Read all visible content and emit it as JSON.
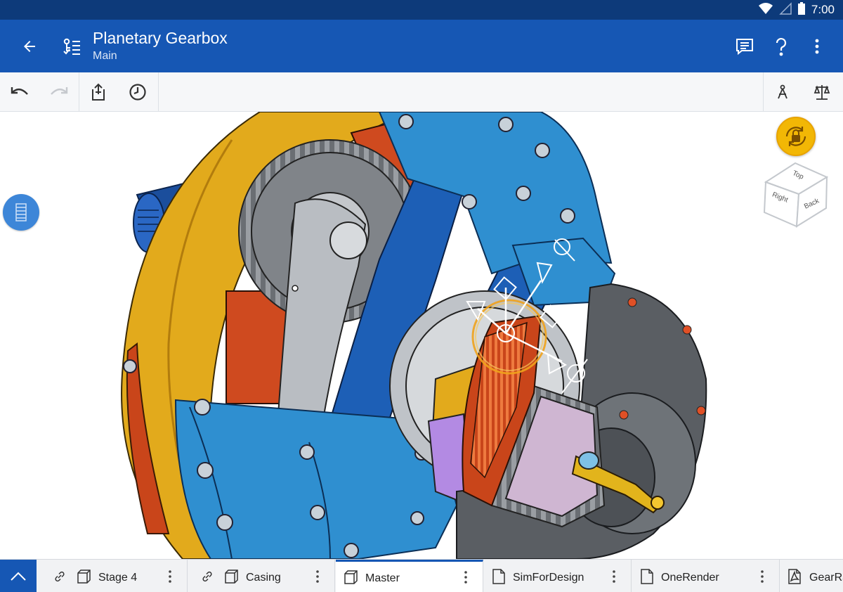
{
  "status_bar": {
    "time": "7:00",
    "icons": [
      "wifi-icon",
      "signal-icon",
      "battery-icon"
    ]
  },
  "header": {
    "title": "Planetary Gearbox",
    "subtitle": "Main",
    "actions": [
      "back-arrow-icon",
      "feature-tree-icon",
      "comments-icon",
      "help-icon",
      "overflow-menu-icon"
    ]
  },
  "toolbar": {
    "left_tools": [
      "undo-icon",
      "redo-icon",
      "export-icon",
      "history-icon"
    ],
    "right_tools": [
      "measure-icon",
      "mass-properties-icon"
    ]
  },
  "view_cube": {
    "top": "Top",
    "right": "Right",
    "back": "Back"
  },
  "colors": {
    "status_bar": "#0d3a7a",
    "header": "#1657b4",
    "accent": "#f2b705",
    "gear_blue": "#2f8fd0",
    "gear_gold": "#e2aa1c",
    "gear_orange": "#d9501e",
    "gear_gray": "#5a5e63",
    "gear_purple": "#b38ae3"
  },
  "tabs": [
    {
      "label": "Stage 4",
      "type": "assembly",
      "linked": true,
      "active": false
    },
    {
      "label": "Casing",
      "type": "assembly",
      "linked": true,
      "active": false
    },
    {
      "label": "Master",
      "type": "assembly",
      "linked": false,
      "active": true
    },
    {
      "label": "SimForDesign",
      "type": "document",
      "linked": false,
      "active": false
    },
    {
      "label": "OneRender",
      "type": "document",
      "linked": false,
      "active": false
    },
    {
      "label": "GearRa",
      "type": "pdf",
      "linked": false,
      "active": false
    }
  ]
}
